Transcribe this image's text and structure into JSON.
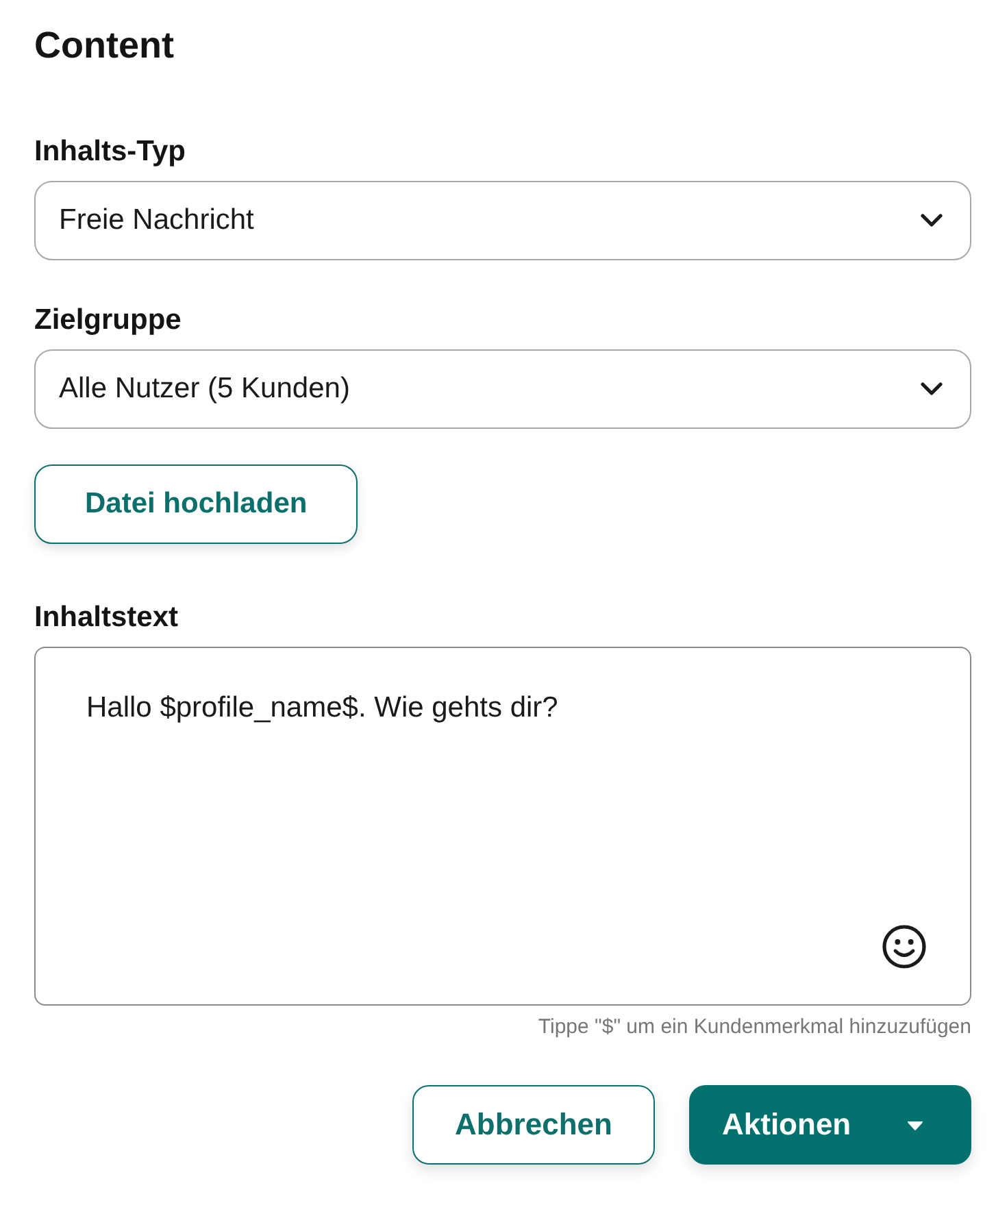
{
  "title": "Content",
  "fields": [
    {
      "kind": "select",
      "label": "Inhalts-Typ",
      "value": "Freie Nachricht"
    },
    {
      "kind": "select",
      "label": "Zielgruppe",
      "value": "Alle Nutzer (5 Kunden)"
    },
    {
      "kind": "upload",
      "label": "Datei hochladen"
    },
    {
      "kind": "textarea",
      "label": "Inhaltstext",
      "value": "Hallo $profile_name$. Wie gehts dir?",
      "hint": "Tippe \"$\" um ein Kundenmerkmal hinzuzufügen"
    }
  ],
  "actions": [
    {
      "kind": "outline",
      "label": "Abbrechen"
    },
    {
      "kind": "dropdown",
      "label": "Aktionen"
    }
  ]
}
